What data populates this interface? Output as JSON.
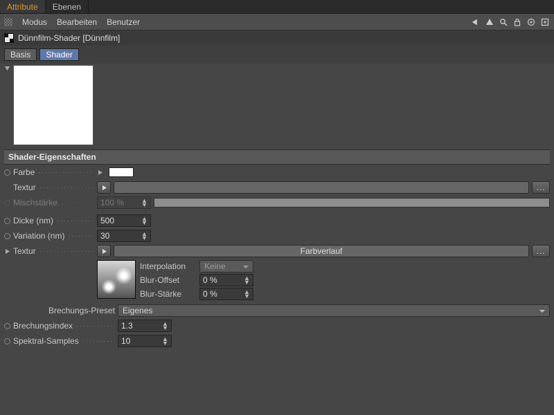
{
  "tabs": {
    "attribute": "Attribute",
    "ebenen": "Ebenen"
  },
  "menu": {
    "modus": "Modus",
    "bearbeiten": "Bearbeiten",
    "benutzer": "Benutzer"
  },
  "title": "Dünnfilm-Shader [Dünnfilm]",
  "subtabs": {
    "basis": "Basis",
    "shader": "Shader"
  },
  "section_header": "Shader-Eigenschaften",
  "labels": {
    "farbe": "Farbe",
    "textur": "Textur",
    "mischstaerke": "Mischstärke",
    "dicke": "Dicke (nm)",
    "variation": "Variation (nm)",
    "interpolation": "Interpolation",
    "blur_offset": "Blur-Offset",
    "blur_staerke": "Blur-Stärke",
    "brechungs_preset": "Brechungs-Preset",
    "brechungsindex": "Brechungsindex",
    "spektral_samples": "Spektral-Samples"
  },
  "values": {
    "mischstaerke": "100 %",
    "dicke": "500",
    "variation": "30",
    "farbverlauf": "Farbverlauf",
    "interpolation": "Keine",
    "blur_offset": "0 %",
    "blur_staerke": "0 %",
    "brechungs_preset": "Eigenes",
    "brechungsindex": "1.3",
    "spektral_samples": "10",
    "more_btn": "..."
  }
}
